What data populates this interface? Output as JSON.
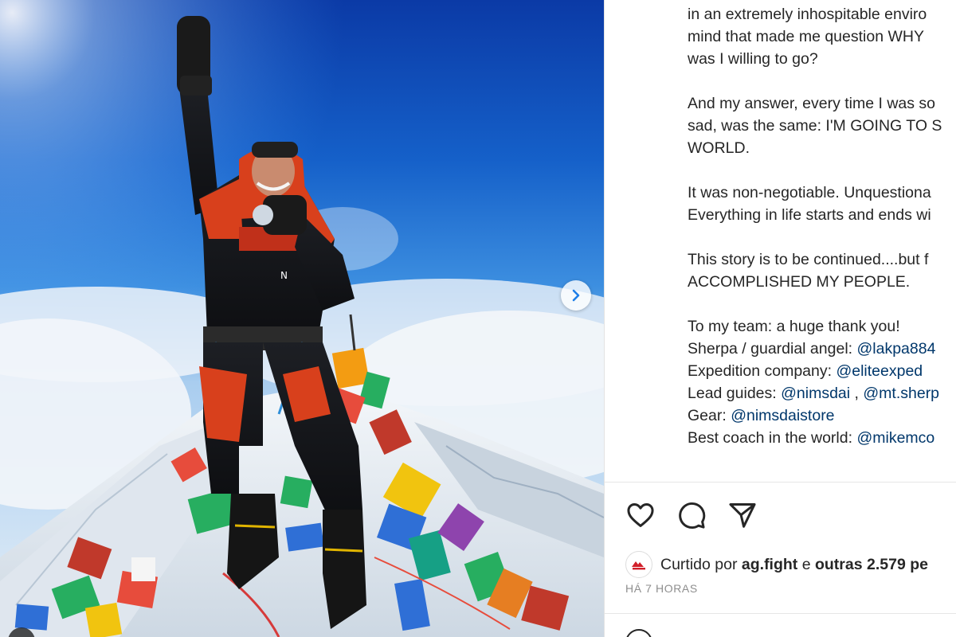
{
  "caption": {
    "lines": [
      {
        "text": "in an extremely inhospitable enviro"
      },
      {
        "text": "mind that made me question WHY"
      },
      {
        "text": "was I willing to go?"
      },
      {
        "text": ""
      },
      {
        "text": "And my answer, every time I was so"
      },
      {
        "text": "sad, was the same: I'M GOING TO S"
      },
      {
        "text": "WORLD."
      },
      {
        "text": ""
      },
      {
        "text": "It was non-negotiable. Unquestiona"
      },
      {
        "text": "Everything in life starts and ends wi"
      },
      {
        "text": ""
      },
      {
        "text": "This story is to be continued....but f"
      },
      {
        "text": "ACCOMPLISHED MY PEOPLE."
      },
      {
        "text": ""
      },
      {
        "text": "To my team: a huge thank you!"
      }
    ],
    "credits": [
      {
        "label": "Sherpa / guardial angel: ",
        "mentions": [
          "@lakpa884"
        ]
      },
      {
        "label": "Expedition company: ",
        "mentions": [
          "@eliteexped"
        ]
      },
      {
        "label": "Lead guides: ",
        "mentions": [
          "@nimsdai",
          "@mt.sherp"
        ],
        "separator": " , "
      },
      {
        "label": "Gear: ",
        "mentions": [
          "@nimsdaistore"
        ]
      },
      {
        "label": "Best coach in the world: ",
        "mentions": [
          "@mikemco"
        ]
      }
    ]
  },
  "actions": {
    "like_icon": "heart-icon",
    "comment_icon": "comment-icon",
    "share_icon": "paper-plane-icon"
  },
  "likes": {
    "prefix": "Curtido por ",
    "user": "ag.fight",
    "middle": " e ",
    "others": "outras 2.579 pe"
  },
  "time": "HÁ 7 HORAS",
  "media": {
    "next_icon": "chevron-right-icon",
    "alt": "Climber celebrating on a snowy summit with prayer flags"
  },
  "colors": {
    "mention": "#00376b",
    "text": "#262626",
    "muted": "#8e8e8e",
    "sky_top": "#0a3fa8",
    "suit_orange": "#d8401c"
  }
}
